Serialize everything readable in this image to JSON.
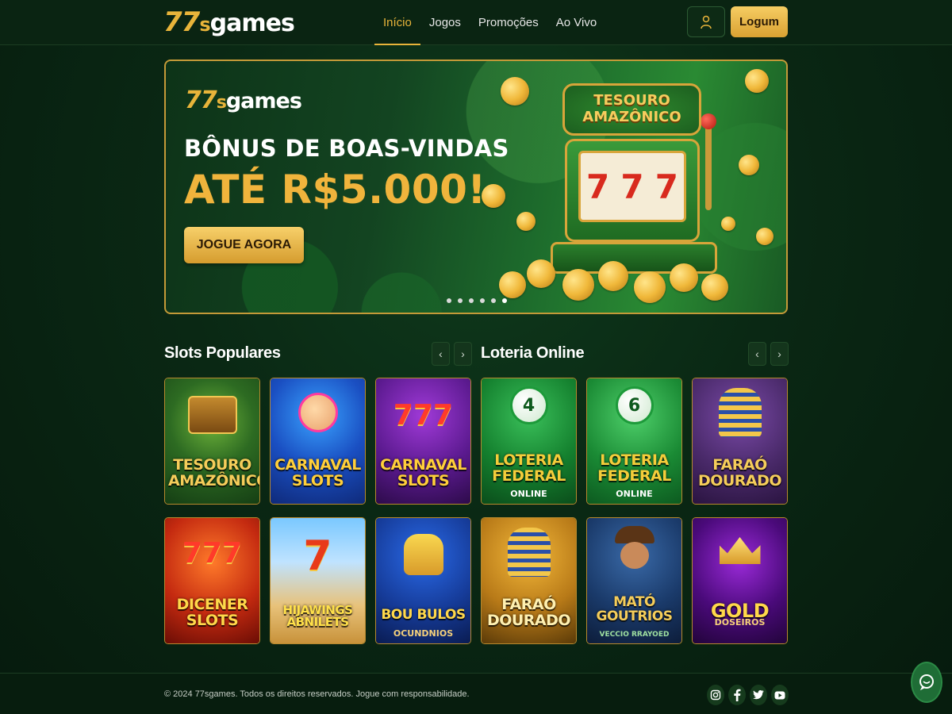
{
  "header": {
    "logo": {
      "num": "77",
      "s": "s",
      "rest": "games"
    },
    "nav": [
      {
        "label": "Início",
        "active": true
      },
      {
        "label": "Jogos",
        "active": false
      },
      {
        "label": "Promoções",
        "active": false
      },
      {
        "label": "Ao Vivo",
        "active": false
      }
    ],
    "user_icon": "user-icon",
    "login_label": "Logum"
  },
  "banner": {
    "logo": {
      "num": "77",
      "s": "s",
      "rest": "games"
    },
    "headline": "BÔNUS DE BOAS-VINDAS",
    "amount": "ATÉ R$5.000!",
    "cta_label": "JOGUE AGORA",
    "sign_line1": "TESOURO",
    "sign_line2": "AMAZÔNICO",
    "reels": [
      "7",
      "7",
      "7"
    ],
    "slide_count": 6,
    "active_slide": 6
  },
  "sections": {
    "slots_title": "Slots Populares",
    "lottery_title": "Loteria Online",
    "prev_icon": "chevron-left-icon",
    "next_icon": "chevron-right-icon"
  },
  "games": [
    {
      "title": "TESOURO AMAZÔNICO",
      "sub": "",
      "theme": "jungle"
    },
    {
      "title": "CARNAVAL SLOTS",
      "sub": "",
      "theme": "carnival-blue"
    },
    {
      "title": "CARNAVAL SLOTS",
      "sub": "",
      "theme": "carnival-purple"
    },
    {
      "title": "LOTERIA FEDERAL",
      "sub": "ONLINE",
      "theme": "lottery-4"
    },
    {
      "title": "LOTERIA FEDERAL",
      "sub": "ONLINE",
      "theme": "lottery-6"
    },
    {
      "title": "FARAÓ DOURADO",
      "sub": "",
      "theme": "pharaoh-purple"
    },
    {
      "title": "DICENER SLOTS",
      "sub": "",
      "theme": "dice-red"
    },
    {
      "title": "HIJAWINGS ABNILETS",
      "sub": "",
      "theme": "desert"
    },
    {
      "title": "BOU BULOS",
      "sub": "OCUNDNIOS",
      "theme": "cards-blue"
    },
    {
      "title": "FARAÓ DOURADO",
      "sub": "",
      "theme": "pharaoh-gold"
    },
    {
      "title": "MATÓ GOUTRIOS",
      "sub": "VECCIO RRAYOED",
      "theme": "explorer"
    },
    {
      "title": "GOLD",
      "sub": "DOSEIROS",
      "theme": "gold-purple"
    }
  ],
  "footer": {
    "copyright": "© 2024 77sgames. Todos os direitos reservados. Jogue com responsabilidade.",
    "social": [
      "instagram-icon",
      "facebook-icon",
      "twitter-icon",
      "youtube-icon"
    ]
  },
  "colors": {
    "accent": "#e8b43a",
    "bg": "#0a2412",
    "border": "#b88a2e"
  }
}
